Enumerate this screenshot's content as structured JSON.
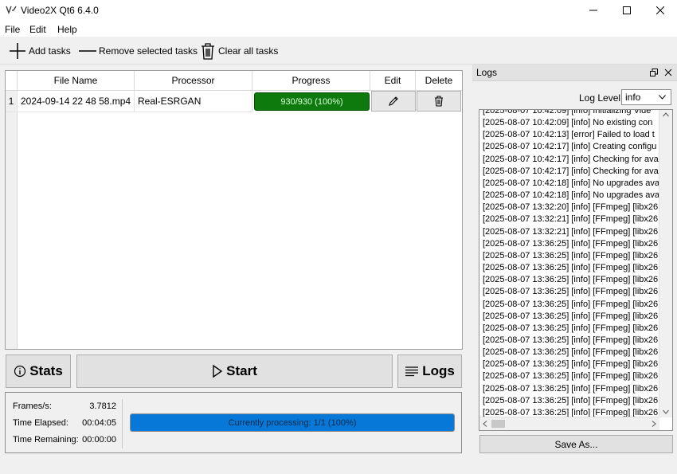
{
  "window": {
    "title": "Video2X Qt6 6.4.0"
  },
  "menu": {
    "file": "File",
    "edit": "Edit",
    "help": "Help"
  },
  "toolbar": {
    "add": "Add tasks",
    "remove": "Remove selected tasks",
    "clear": "Clear all tasks"
  },
  "table": {
    "headers": {
      "file_name": "File Name",
      "processor": "Processor",
      "progress": "Progress",
      "edit": "Edit",
      "delete": "Delete"
    },
    "rows": [
      {
        "num": "1",
        "file_name": "2024-09-14 22 48 58.mp4",
        "processor": "Real-ESRGAN",
        "progress_text": "930/930 (100%)",
        "progress_fraction": 1.0
      }
    ]
  },
  "buttons": {
    "stats": "Stats",
    "start": "Start",
    "logs": "Logs",
    "save_as": "Save As..."
  },
  "stats": {
    "fps_label": "Frames/s:",
    "fps_value": "3.7812",
    "elapsed_label": "Time Elapsed:",
    "elapsed_value": "00:04:05",
    "remaining_label": "Time Remaining:",
    "remaining_value": "00:00:00",
    "overall_text": "Currently processing: 1/1 (100%)",
    "overall_fraction": 1.0
  },
  "logs": {
    "title": "Logs",
    "level_label": "Log Level",
    "level_value": "info",
    "lines": [
      "[2025-08-07 10:42:09] [info] Initializing Vide",
      "[2025-08-07 10:42:09] [info] No existing con",
      "[2025-08-07 10:42:13] [error] Failed to load t",
      "[2025-08-07 10:42:17] [info] Creating configu",
      "[2025-08-07 10:42:17] [info] Checking for ava",
      "[2025-08-07 10:42:17] [info] Checking for ava",
      "[2025-08-07 10:42:18] [info] No upgrades ava",
      "[2025-08-07 10:42:18] [info] No upgrades ava",
      "[2025-08-07 13:32:20] [info] [FFmpeg] [libx26",
      "[2025-08-07 13:32:21] [info] [FFmpeg] [libx26",
      "[2025-08-07 13:32:21] [info] [FFmpeg] [libx26",
      "[2025-08-07 13:36:25] [info] [FFmpeg] [libx26",
      "[2025-08-07 13:36:25] [info] [FFmpeg] [libx26",
      "[2025-08-07 13:36:25] [info] [FFmpeg] [libx26",
      "[2025-08-07 13:36:25] [info] [FFmpeg] [libx26",
      "[2025-08-07 13:36:25] [info] [FFmpeg] [libx26",
      "[2025-08-07 13:36:25] [info] [FFmpeg] [libx26",
      "[2025-08-07 13:36:25] [info] [FFmpeg] [libx26",
      "[2025-08-07 13:36:25] [info] [FFmpeg] [libx26",
      "[2025-08-07 13:36:25] [info] [FFmpeg] [libx26",
      "[2025-08-07 13:36:25] [info] [FFmpeg] [libx26",
      "[2025-08-07 13:36:25] [info] [FFmpeg] [libx26",
      "[2025-08-07 13:36:25] [info] [FFmpeg] [libx26",
      "[2025-08-07 13:36:25] [info] [FFmpeg] [libx26",
      "[2025-08-07 13:36:25] [info] [FFmpeg] [libx26",
      "[2025-08-07 13:36:25] [info] [FFmpeg] [libx26"
    ]
  },
  "colors": {
    "progress_green": "#0e7a0e",
    "progress_blue": "#0878d8"
  }
}
